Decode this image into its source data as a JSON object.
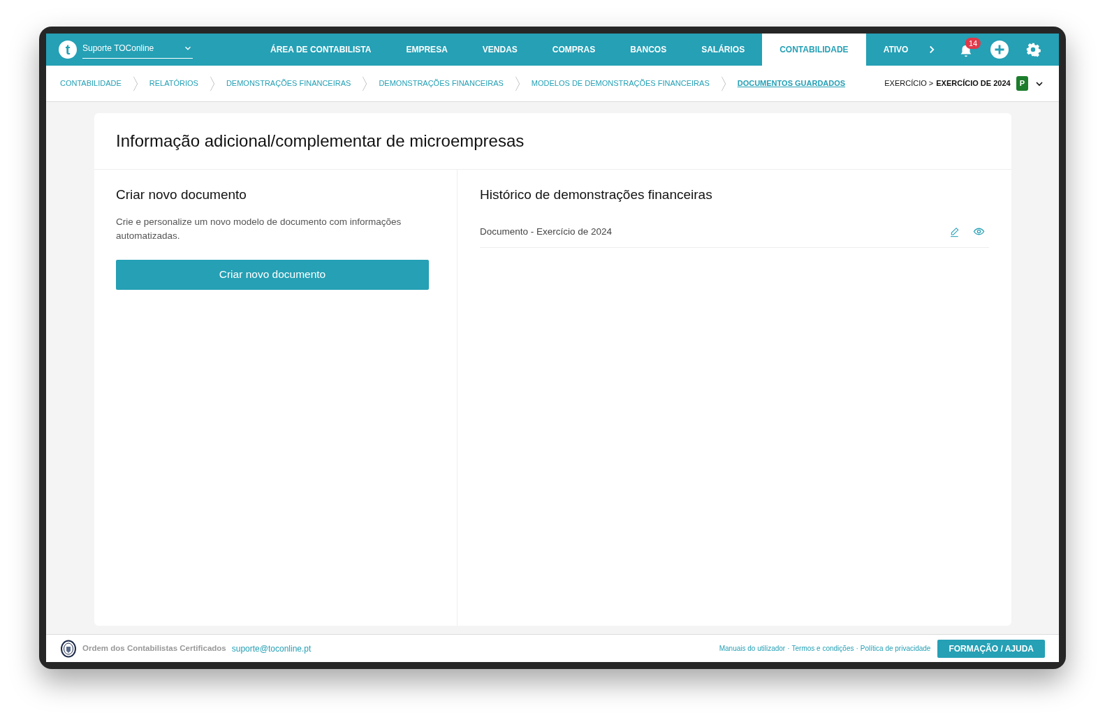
{
  "app": {
    "logo_text": "t",
    "account": "Suporte TOConline"
  },
  "nav_tabs": [
    {
      "label": "ÁREA DE CONTABILISTA",
      "selected": false
    },
    {
      "label": "EMPRESA",
      "selected": false
    },
    {
      "label": "VENDAS",
      "selected": false
    },
    {
      "label": "COMPRAS",
      "selected": false
    },
    {
      "label": "BANCOS",
      "selected": false
    },
    {
      "label": "SALÁRIOS",
      "selected": false
    },
    {
      "label": "CONTABILIDADE",
      "selected": true
    },
    {
      "label": "ATIVO",
      "selected": false
    }
  ],
  "notifications": {
    "count": "14"
  },
  "breadcrumbs": [
    {
      "label": "CONTABILIDADE",
      "selected": false
    },
    {
      "label": "RELATÓRIOS",
      "selected": false
    },
    {
      "label": "DEMONSTRAÇÕES FINANCEIRAS",
      "selected": false
    },
    {
      "label": "DEMONSTRAÇÕES FINANCEIRAS",
      "selected": false
    },
    {
      "label": "MODELOS DE DEMONSTRAÇÕES FINANCEIRAS",
      "selected": false
    },
    {
      "label": "DOCUMENTOS GUARDADOS",
      "selected": true
    }
  ],
  "exercise": {
    "prefix": "EXERCÍCIO >",
    "value": "EXERCÍCIO DE 2024",
    "badge": "P"
  },
  "page_title": "Informação adicional/complementar de microempresas",
  "create_panel": {
    "title": "Criar novo documento",
    "description": "Crie e personalize um novo modelo de documento com informações automatizadas.",
    "button": "Criar novo documento"
  },
  "history_panel": {
    "title": "Histórico de demonstrações financeiras",
    "documents": [
      {
        "name": "Documento - Exercício de 2024"
      }
    ]
  },
  "footer": {
    "organization": "Ordem dos Contabilistas Certificados",
    "email": "suporte@toconline.pt",
    "links": [
      "Manuais do utilizador",
      "Termos e condições",
      "Política de privacidade"
    ],
    "separator": "·",
    "button": "FORMAÇÃO / AJUDA"
  }
}
